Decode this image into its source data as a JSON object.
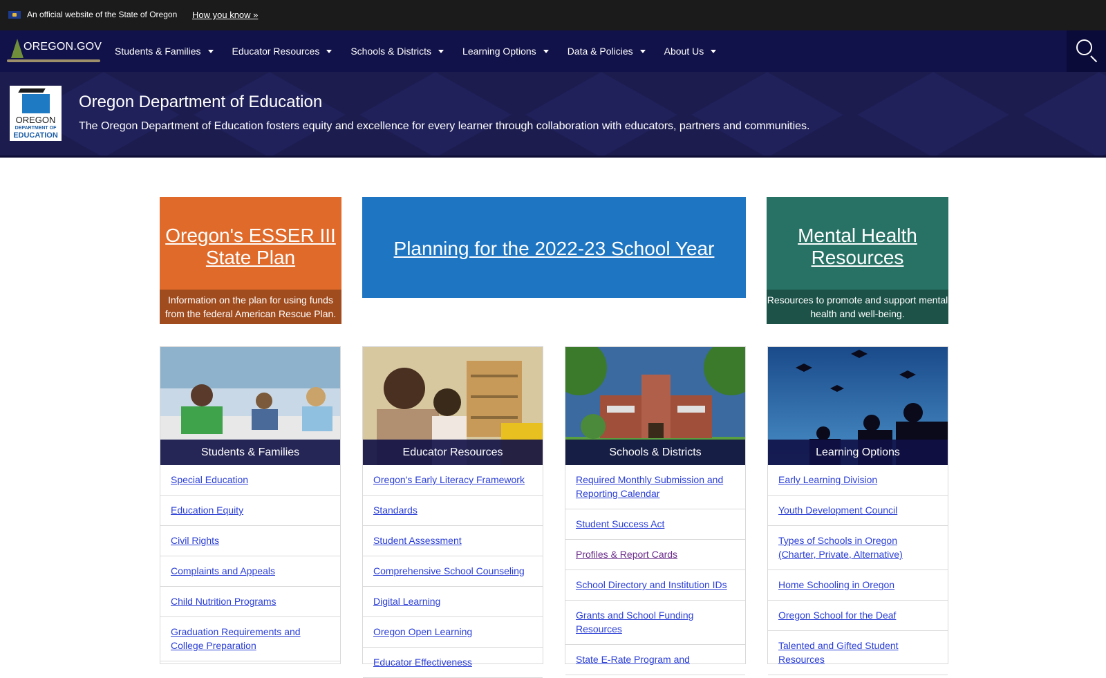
{
  "official_bar": {
    "text": "An official website of the State of Oregon",
    "how_link": "How you know »"
  },
  "nav": {
    "logo_text": "OREGON.GOV",
    "items": [
      {
        "label": "Students & Families"
      },
      {
        "label": "Educator Resources"
      },
      {
        "label": "Schools & Districts"
      },
      {
        "label": "Learning Options"
      },
      {
        "label": "Data & Policies"
      },
      {
        "label": "About Us"
      }
    ]
  },
  "agency": {
    "logo_line1": "OREGON",
    "logo_line2": "DEPARTMENT OF",
    "logo_line3": "EDUCATION",
    "title": "Oregon Department of Education",
    "tagline": "The Oregon Department of Education fosters equity and excellence for every learner through collaboration with educators, partners and communities."
  },
  "features": {
    "esser": {
      "title": "Oregon's ESSER III State Plan",
      "desc": "Information on the plan for using funds from the federal American Rescue Plan."
    },
    "plan": {
      "title": "Planning for the 2022-23 School Year"
    },
    "mental": {
      "title": "Mental Health Resources",
      "desc": "Resources to promote and support mental health and well-being."
    }
  },
  "cards": {
    "students": {
      "title": "Students & Families",
      "links": [
        "Special Education",
        "Education Equity",
        "Civil Rights",
        "Complaints and Appeals",
        "Child Nutrition Programs",
        "Graduation Requirements and College Preparation"
      ]
    },
    "educators": {
      "title": "Educator Resources",
      "links": [
        "Oregon's Early Literacy Framework",
        "Standards",
        "Student Assessment",
        "Comprehensive School Counseling",
        "Digital Learning",
        "Oregon Open Learning",
        "Educator Effectiveness"
      ]
    },
    "schools": {
      "title": "Schools & Districts",
      "links": [
        "Required Monthly Submission and Reporting Calendar",
        "Student Success Act",
        "Profiles & Report Cards",
        "School Directory and Institution IDs",
        "Grants and School Funding Resources",
        "State E-Rate Program and"
      ]
    },
    "learning": {
      "title": "Learning Options",
      "links": [
        "Early Learning Division",
        "Youth Development Council",
        "Types of Schools in Oregon (Charter, Private, Alternative)",
        "Home Schooling in Oregon",
        "Oregon School for the Deaf",
        "Talented and Gifted Student Resources"
      ]
    }
  }
}
